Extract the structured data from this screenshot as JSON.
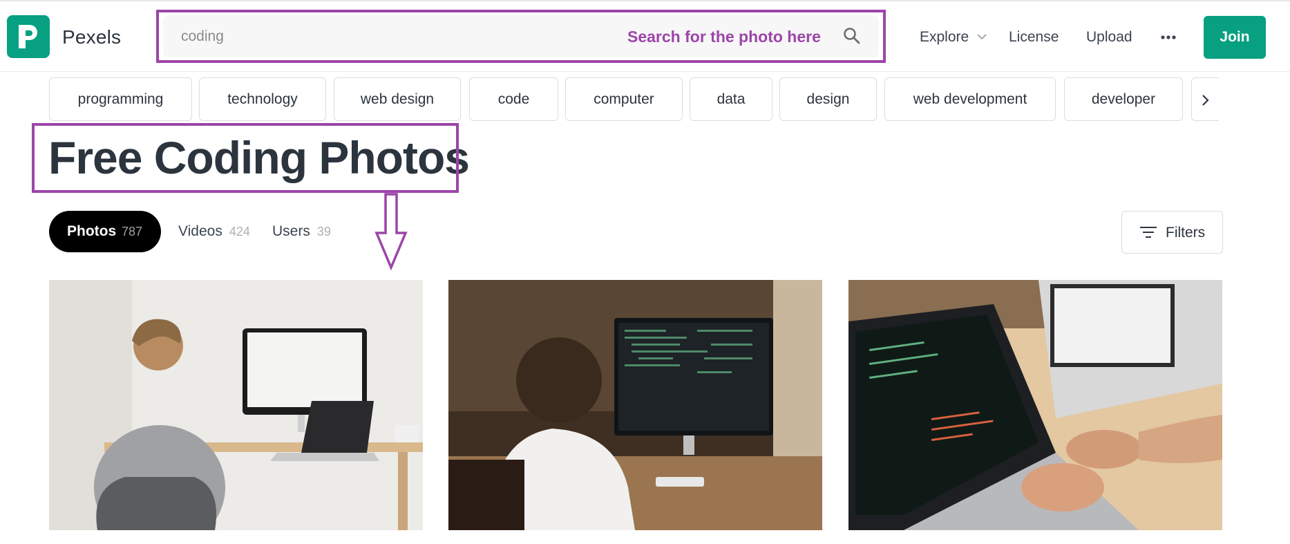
{
  "brand": {
    "name": "Pexels",
    "accent": "#07a081",
    "icon": "pexels-logo-icon"
  },
  "search": {
    "value": "coding",
    "annotation": "Search for the photo here",
    "annotation_color": "#9c45a8",
    "icon": "search-icon"
  },
  "nav": {
    "explore": "Explore",
    "license": "License",
    "upload": "Upload",
    "more_icon": "more-horizontal-icon",
    "join": "Join"
  },
  "tags": [
    "programming",
    "technology",
    "web design",
    "code",
    "computer",
    "data",
    "design",
    "web development",
    "developer"
  ],
  "title": "Free Coding Photos",
  "tabs": {
    "photos": {
      "label": "Photos",
      "count": "787"
    },
    "videos": {
      "label": "Videos",
      "count": "424"
    },
    "users": {
      "label": "Users",
      "count": "39"
    }
  },
  "filters": {
    "label": "Filters",
    "icon": "filter-icon"
  },
  "photos": [
    {
      "alt": "Man working at desktop computer and laptop in bright room"
    },
    {
      "alt": "Child coding on monitor in dim room"
    },
    {
      "alt": "Hands typing on laptop with code on screen"
    }
  ]
}
